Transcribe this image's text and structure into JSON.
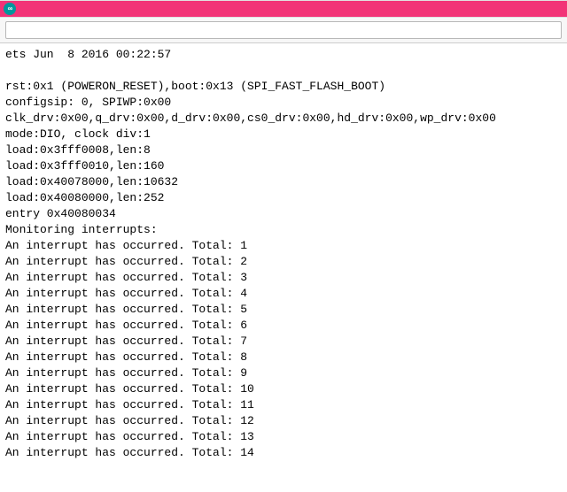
{
  "titlebar": {
    "icon_label": "∞"
  },
  "input": {
    "value": "",
    "placeholder": ""
  },
  "output_lines": [
    "ets Jun  8 2016 00:22:57",
    "",
    "rst:0x1 (POWERON_RESET),boot:0x13 (SPI_FAST_FLASH_BOOT)",
    "configsip: 0, SPIWP:0x00",
    "clk_drv:0x00,q_drv:0x00,d_drv:0x00,cs0_drv:0x00,hd_drv:0x00,wp_drv:0x00",
    "mode:DIO, clock div:1",
    "load:0x3fff0008,len:8",
    "load:0x3fff0010,len:160",
    "load:0x40078000,len:10632",
    "load:0x40080000,len:252",
    "entry 0x40080034",
    "Monitoring interrupts:",
    "An interrupt has occurred. Total: 1",
    "An interrupt has occurred. Total: 2",
    "An interrupt has occurred. Total: 3",
    "An interrupt has occurred. Total: 4",
    "An interrupt has occurred. Total: 5",
    "An interrupt has occurred. Total: 6",
    "An interrupt has occurred. Total: 7",
    "An interrupt has occurred. Total: 8",
    "An interrupt has occurred. Total: 9",
    "An interrupt has occurred. Total: 10",
    "An interrupt has occurred. Total: 11",
    "An interrupt has occurred. Total: 12",
    "An interrupt has occurred. Total: 13",
    "An interrupt has occurred. Total: 14"
  ]
}
